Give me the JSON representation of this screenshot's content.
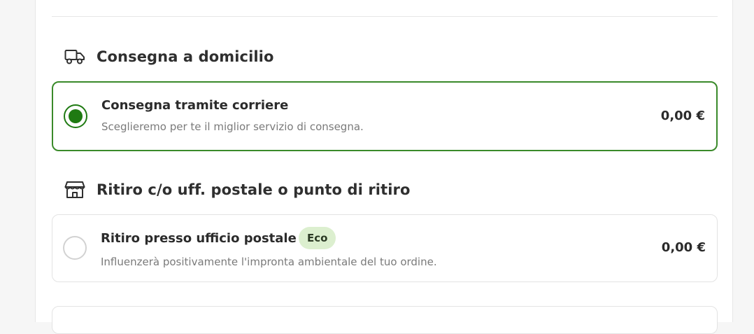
{
  "sections": {
    "home_delivery": {
      "title": "Consegna a domicilio",
      "icon": "truck-icon",
      "option": {
        "title": "Consegna tramite corriere",
        "description": "Sceglieremo per te il miglior servizio di consegna.",
        "price": "0,00 €",
        "selected": true
      }
    },
    "pickup": {
      "title": "Ritiro c/o uff. postale o punto di ritiro",
      "icon": "store-icon",
      "option": {
        "title": "Ritiro presso ufficio postale",
        "badge": "Eco",
        "description": "Influenzerà positivamente l'impronta ambientale del tuo ordine.",
        "price": "0,00 €",
        "selected": false
      }
    }
  },
  "colors": {
    "accent_green": "#1f7a12",
    "selected_border": "#3a8a2a",
    "badge_bg": "#dcefcf"
  }
}
